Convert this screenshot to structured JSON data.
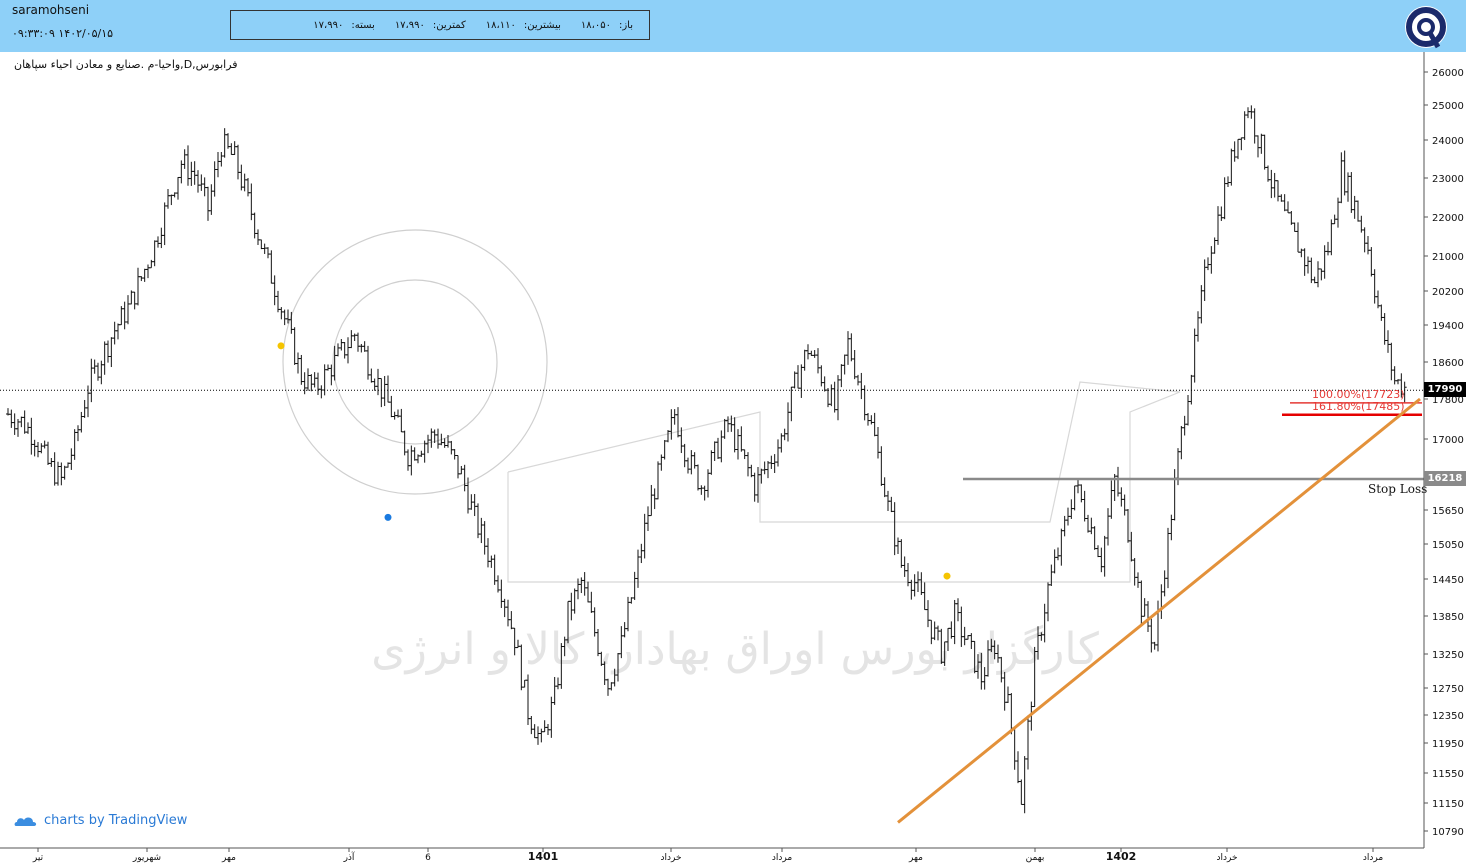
{
  "header": {
    "username": "saramohseni",
    "timestamp": "۱۴۰۲/۰۵/۱۵ ۰۹:۳۳:۰۹",
    "ohlc": [
      {
        "label": "باز:",
        "value": "۱۸،۰۵۰"
      },
      {
        "label": "بیشترین:",
        "value": "۱۸،۱۱۰"
      },
      {
        "label": "کمترین:",
        "value": "۱۷،۹۹۰"
      },
      {
        "label": "بسته:",
        "value": "۱۷،۹۹۰"
      }
    ]
  },
  "symbol_label": "فرابورس,D,واحیا-م .صنایع و معادن احیاء سپاهان",
  "watermark_text": "کارگزار بورس اوراق بهادار، کالا و انرژی",
  "branding": {
    "tradingview": "charts by TradingView"
  },
  "chart_data": {
    "type": "ohlc",
    "y_ticks": [
      26000,
      25000,
      24000,
      23000,
      22000,
      21000,
      20200,
      19400,
      18600,
      17800,
      17000,
      16218,
      15650,
      15050,
      14450,
      13850,
      13250,
      12750,
      12350,
      11950,
      11550,
      11150,
      10790
    ],
    "ylim": [
      10700,
      26300
    ],
    "x_ticks": [
      "تیر",
      "شهریور",
      "مهر",
      "آذر",
      "6",
      "1401",
      "خرداد",
      "مرداد",
      "مهر",
      "بهمن",
      "1402",
      "خرداد",
      "مرداد"
    ],
    "last_price": {
      "value": 17990,
      "label": "17990",
      "color": "#000000"
    },
    "stop_loss": {
      "value": 16218,
      "label": "16218",
      "text": "Stop Loss",
      "color": "#8a8a8a"
    },
    "fibonacci": [
      {
        "level": "100.00%",
        "price": "(17723)",
        "value": 17723
      },
      {
        "level": "161.80%",
        "price": "(17485)",
        "value": 17485
      }
    ],
    "trendline": {
      "from": {
        "x": "مهر",
        "y": 10900
      },
      "to": {
        "x": "مرداد",
        "y": 17800
      },
      "color": "#e3913a"
    },
    "markers": [
      {
        "x": "مهر",
        "y": 18950,
        "color": "#f5c400"
      },
      {
        "x": "آذر",
        "y": 15520,
        "color": "#1a7ae0"
      },
      {
        "x": "مهر",
        "y": 14500,
        "color": "#f5c400"
      }
    ],
    "series": [
      {
        "values": [
          17500,
          17350,
          17050,
          16500,
          16200,
          16900,
          18050,
          18700,
          19300,
          19800,
          20500,
          21300,
          22400,
          23400,
          23100,
          22200,
          23900,
          23500,
          22400,
          21300,
          20300,
          19300,
          18300,
          18000,
          18400,
          18800,
          19200,
          18600,
          18000,
          17400,
          16700,
          16900,
          17100,
          16800,
          16300,
          15500,
          14900,
          14300,
          13500,
          12400,
          11950,
          12600,
          13900,
          14400,
          13600,
          12800,
          13400,
          14400,
          15600,
          16500,
          17500,
          16600,
          16100,
          16700,
          17300,
          16700,
          16100,
          16500,
          17000,
          18100,
          18900,
          18300,
          17600,
          19000,
          18000,
          17000,
          15700,
          14700,
          14400,
          13800,
          13300,
          13850,
          13400,
          12900,
          13400,
          12500,
          11200,
          13100,
          14300,
          15100,
          16100,
          15500,
          14800,
          16200,
          15300,
          14000,
          13400,
          15100,
          17100,
          18900,
          21000,
          22300,
          23800,
          25000,
          23800,
          22600,
          21800,
          21100,
          20400,
          21200,
          23200,
          22300,
          21200,
          19400,
          18200,
          17990
        ]
      }
    ]
  }
}
